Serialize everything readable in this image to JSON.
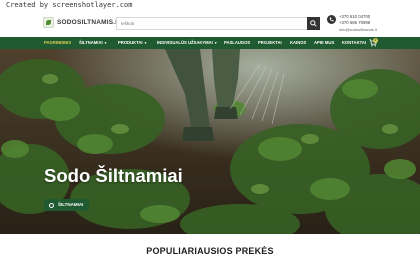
{
  "watermark": "Created by screenshotlayer.com",
  "brand": {
    "logo_text": "SODOSILTNAMIS.LT",
    "accent": "#1f5a31",
    "highlight": "#e2d15a"
  },
  "search": {
    "placeholder": "Ieškoti"
  },
  "contact": {
    "phone_1": "+370 610 04700",
    "phone_2": "+370 686 70998",
    "email": "info@sodosiltnamis.lt"
  },
  "nav": {
    "items": [
      {
        "label": "PAGRINDINIS",
        "active": true
      },
      {
        "label": "ŠILTNAMIAI",
        "dropdown": true
      },
      {
        "label": "PRODUKTAI",
        "dropdown": true
      },
      {
        "label": "INDIVIDUALŪS UŽSAKYMAI",
        "dropdown": true
      },
      {
        "label": "PASLAUGOS"
      },
      {
        "label": "PROJEKTAI"
      },
      {
        "label": "KAINOS"
      },
      {
        "label": "APIE MUS"
      },
      {
        "label": "KONTAKTAI"
      }
    ],
    "cart_count": "0"
  },
  "hero": {
    "title": "Sodo Šiltnamiai",
    "button_label": "ŠILTNAMIAI"
  },
  "popular": {
    "title": "POPULIARIAUSIOS PREKĖS"
  }
}
